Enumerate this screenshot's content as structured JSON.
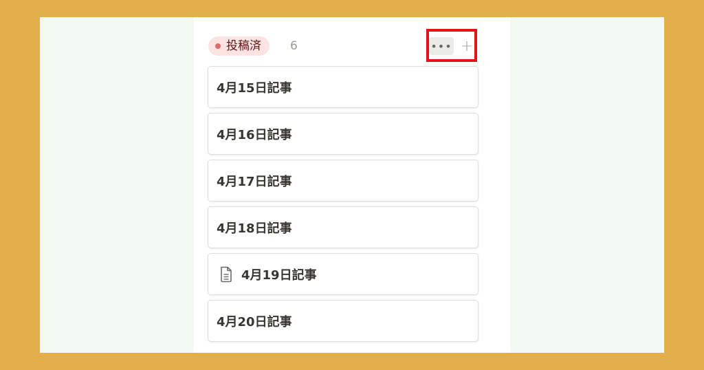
{
  "group": {
    "status_label": "投稿済",
    "count": "6",
    "colors": {
      "tag_bg": "#fde4e2",
      "dot": "#e06c66",
      "text": "#5d1715",
      "highlight": "#e3121b"
    },
    "more_icon": "more-horizontal-icon",
    "add_icon": "plus-icon"
  },
  "cards": [
    {
      "title": "4月15日記事"
    },
    {
      "title": "4月16日記事"
    },
    {
      "title": "4月17日記事"
    },
    {
      "title": "4月18日記事"
    },
    {
      "title": "4月19日記事",
      "icon": "document-icon"
    },
    {
      "title": "4月20日記事"
    }
  ]
}
